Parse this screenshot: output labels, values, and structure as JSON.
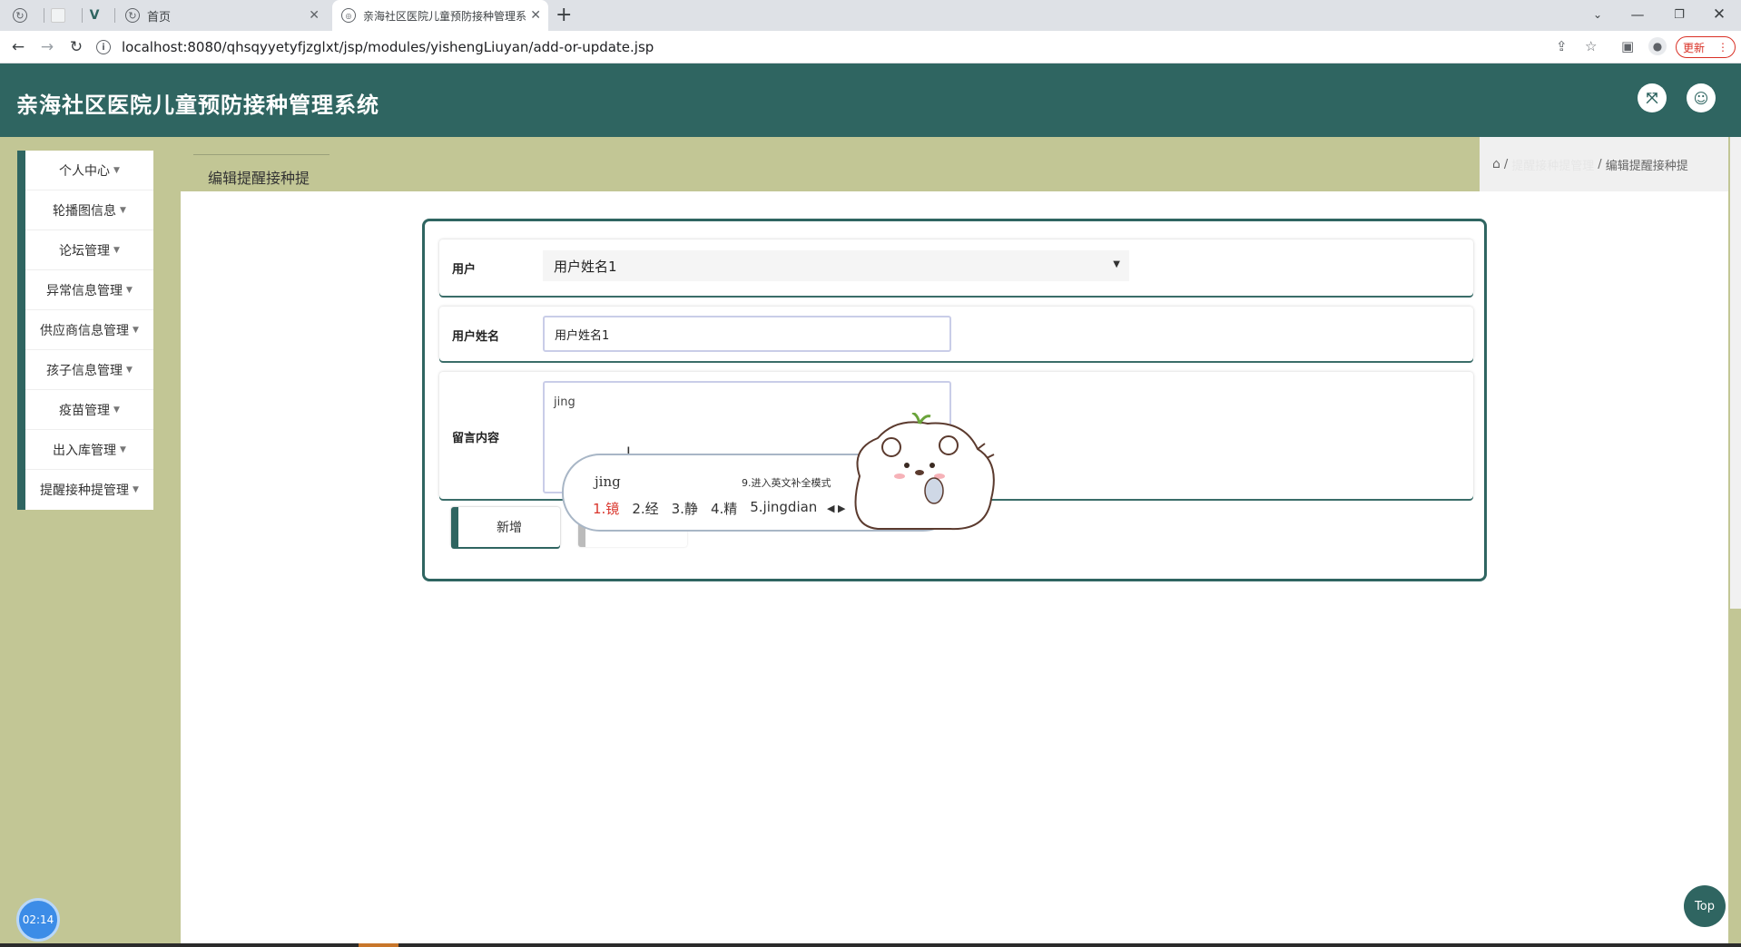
{
  "browser": {
    "tabs": [
      {
        "label": ""
      },
      {
        "label": ""
      },
      {
        "label": ""
      },
      {
        "label": "首页"
      },
      {
        "label": "亲海社区医院儿童预防接种管理系"
      }
    ],
    "url": "localhost:8080/qhsqyyetyfjzglxt/jsp/modules/yishengLiuyan/add-or-update.jsp",
    "update_label": "更新"
  },
  "app": {
    "title": "亲海社区医院儿童预防接种管理系统"
  },
  "sidebar": {
    "items": [
      {
        "label": "个人中心"
      },
      {
        "label": "轮播图信息"
      },
      {
        "label": "论坛管理"
      },
      {
        "label": "异常信息管理"
      },
      {
        "label": "供应商信息管理"
      },
      {
        "label": "孩子信息管理"
      },
      {
        "label": "疫苗管理"
      },
      {
        "label": "出入库管理"
      },
      {
        "label": "提醒接种提管理"
      }
    ]
  },
  "page": {
    "tab_title": "编辑提醒接种提",
    "breadcrumb": {
      "parent": "提醒接种提管理",
      "current": "编辑提醒接种提"
    }
  },
  "form": {
    "user_label": "用户",
    "user_selected": "用户姓名1",
    "username_label": "用户姓名",
    "username_value": "用户姓名1",
    "message_label": "留言内容",
    "message_value": "jing",
    "add_button": "新增"
  },
  "ime": {
    "composition": "jing",
    "hint": "9.进入英文补全模式",
    "candidates": [
      "1.镜",
      "2.经",
      "3.静",
      "4.精",
      "5.jingdian"
    ]
  },
  "clock": "02:14",
  "top_button": "Top",
  "colors": {
    "header": "#2f6561",
    "page_bg": "#c2c695",
    "ime_highlight": "#d9342b"
  }
}
